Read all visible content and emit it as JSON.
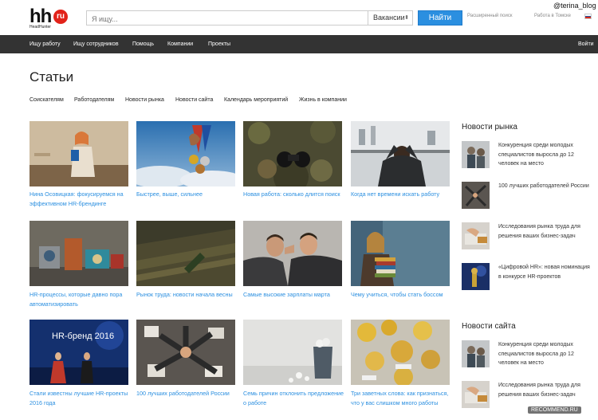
{
  "watermark": "@terina_blog",
  "header": {
    "logo_text": "hh",
    "logo_badge": "ru",
    "logo_sub": "HeadHunter",
    "search_placeholder": "Я ищу...",
    "vacancy_select": "Вакансии",
    "find_button": "Найти",
    "advanced_link": "Расширенный поиск",
    "city_link": "Работа в Томске",
    "flag_colors": [
      "#ffffff",
      "#1c57a5",
      "#d52b1e"
    ]
  },
  "nav": {
    "items": [
      "Ищу работу",
      "Ищу сотрудников",
      "Помощь",
      "Компании",
      "Проекты"
    ],
    "login": "Войти"
  },
  "page_title": "Статьи",
  "tabs": [
    "Соискателям",
    "Работодателям",
    "Новости рынка",
    "Новости сайта",
    "Календарь мероприятий",
    "Жизнь в компании"
  ],
  "articles": [
    {
      "caption": "Нина Осовицкая: фокусируемся на эффективном HR-брендинге",
      "image": "woman-presenting-photo"
    },
    {
      "caption": "Быстрее, выше, сильнее",
      "image": "medals-photo"
    },
    {
      "caption": "Новая работа: сколько длится поиск",
      "image": "binoculars-camouflage-photo"
    },
    {
      "caption": "Когда нет времени искать работу",
      "image": "man-at-window-photo"
    },
    {
      "caption": "HR-процессы, которые давно пора автоматизировать",
      "image": "toy-robots-photo"
    },
    {
      "caption": "Рынок труда: новости начала весны",
      "image": "field-photo"
    },
    {
      "caption": "Самые высокие зарплаты марта",
      "image": "men-whispering-photo"
    },
    {
      "caption": "Чему учиться, чтобы стать боссом",
      "image": "woman-with-books-photo"
    },
    {
      "caption": "Стали известны лучшие HR-проекты 2016 года",
      "image": "hr-brand-stage-photo"
    },
    {
      "caption": "100 лучших работодателей России",
      "image": "team-hands-photo"
    },
    {
      "caption": "Семь причин отклонить предложение о работе",
      "image": "paper-bin-photo"
    },
    {
      "caption": "Три заветных слова: как признаться, что у вас слишком много работы",
      "image": "workers-pile-photo"
    }
  ],
  "stage_text": "HR-бренд 2016",
  "sidebar": {
    "market_title": "Новости рынка",
    "market_items": [
      "Конкуренция среди молодых специалистов выросла до 12 человек на место",
      "100 лучших работодателей России",
      "Исследования рынка труда для решения ваших бизнес-задач",
      "«Цифровой HR»: новая номинация в конкурсе HR-проектов"
    ],
    "site_title": "Новости сайта",
    "site_items": [
      "Конкуренция среди молодых специалистов выросла до 12 человек на место",
      "Исследования рынка труда для решения ваших бизнес-задач"
    ]
  },
  "recommend_badge": "RECOMMEND.RU"
}
